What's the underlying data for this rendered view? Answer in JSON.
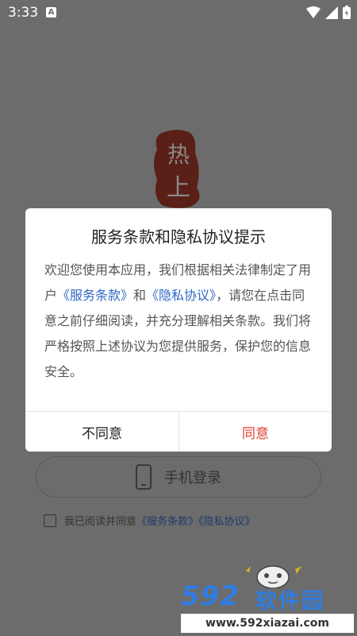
{
  "status_bar": {
    "time": "3:33",
    "notification_letter": "A"
  },
  "login": {
    "phone_login_label": "手机登录",
    "agree_text": "我已阅读并同意",
    "terms_link": "《服务条款》",
    "privacy_link": "《隐私协议》"
  },
  "dialog": {
    "title": "服务条款和隐私协议提示",
    "body_before": "欢迎您使用本应用，我们根据相关法律制定了用户",
    "terms_link": "《服务条款》",
    "body_and": "和",
    "privacy_link": "《隐私协议》",
    "body_after": "，请您在点击同意之前仔细阅读，并充分理解相关条款。我们将严格按照上述协议为您提供服务，保护您的信息安全。",
    "disagree_label": "不同意",
    "agree_label": "同意"
  },
  "watermark": {
    "number": "592",
    "name": "软件园",
    "url": "www.592xiazai.com"
  },
  "colors": {
    "link": "#2f68c6",
    "agree": "#e0402f",
    "watermark": "#2f7de1"
  }
}
